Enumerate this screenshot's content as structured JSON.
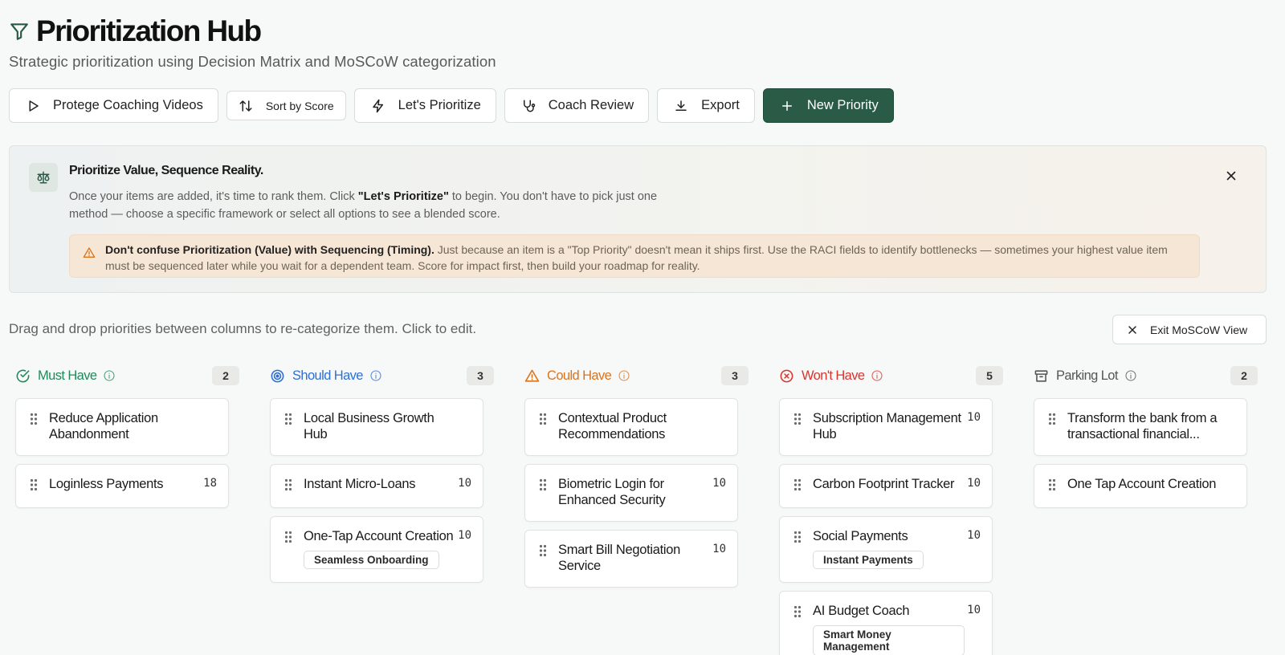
{
  "header": {
    "title": "Prioritization Hub",
    "subtitle": "Strategic prioritization using Decision Matrix and MoSCoW categorization"
  },
  "toolbar": {
    "protege_label": "Protege Coaching Videos",
    "sort_label": "Sort by Score",
    "prioritize_label": "Let's Prioritize",
    "coach_label": "Coach Review",
    "export_label": "Export",
    "new_label": "New Priority"
  },
  "banner": {
    "title": "Prioritize Value, Sequence Reality.",
    "body_1": "Once your items are added, it's time to rank them. Click ",
    "body_bold": "\"Let's Prioritize\"",
    "body_2": " to begin. You don't have to pick just one method — choose a specific framework or select all options to see a blended score.",
    "callout_bold": "Don't confuse Prioritization (Value) with Sequencing (Timing).",
    "callout_text": " Just because an item is a \"Top Priority\" doesn't mean it ships first. Use the RACI fields to identify bottlenecks — sometimes your highest value item must be sequenced later while you wait for a dependent team. Score for impact first, then build your roadmap for reality."
  },
  "hint": "Drag and drop priorities between columns to re-categorize them. Click to edit.",
  "exit_label": "Exit MoSCoW View",
  "columns": [
    {
      "title": "Must Have",
      "count": "2",
      "color": "#1f8a5a",
      "cards": [
        {
          "title": "Reduce Application Abandonment",
          "score": "",
          "tag": ""
        },
        {
          "title": "Loginless Payments",
          "score": "18",
          "tag": ""
        }
      ]
    },
    {
      "title": "Should Have",
      "count": "3",
      "color": "#2f6fd1",
      "cards": [
        {
          "title": "Local Business Growth Hub",
          "score": "",
          "tag": ""
        },
        {
          "title": "Instant Micro-Loans",
          "score": "10",
          "tag": ""
        },
        {
          "title": "One-Tap Account Creation",
          "score": "10",
          "tag": "Seamless Onboarding"
        }
      ]
    },
    {
      "title": "Could Have",
      "count": "3",
      "color": "#d9741f",
      "cards": [
        {
          "title": "Contextual Product Recommendations",
          "score": "",
          "tag": ""
        },
        {
          "title": "Biometric Login for Enhanced Security",
          "score": "10",
          "tag": ""
        },
        {
          "title": "Smart Bill Negotiation Service",
          "score": "10",
          "tag": ""
        }
      ]
    },
    {
      "title": "Won't Have",
      "count": "5",
      "color": "#d9352f",
      "cards": [
        {
          "title": "Subscription Management Hub",
          "score": "10",
          "tag": ""
        },
        {
          "title": "Carbon Footprint Tracker",
          "score": "10",
          "tag": ""
        },
        {
          "title": "Social Payments",
          "score": "10",
          "tag": "Instant Payments"
        },
        {
          "title": "AI Budget Coach",
          "score": "10",
          "tag": "Smart Money Management"
        }
      ]
    },
    {
      "title": "Parking Lot",
      "count": "2",
      "color": "#555555",
      "cards": [
        {
          "title": "Transform the bank from a transactional financial...",
          "score": "",
          "tag": ""
        },
        {
          "title": "One Tap Account Creation",
          "score": "",
          "tag": ""
        }
      ]
    }
  ],
  "icons": {
    "title": "filter-icon",
    "protege": "play-icon",
    "sort": "sort-arrows-icon",
    "prioritize": "lightning-icon",
    "coach": "stethoscope-icon",
    "export": "download-icon",
    "new": "plus-icon",
    "banner": "scale-icon",
    "close": "close-icon",
    "warning": "warning-icon",
    "must": "check-circle-icon",
    "should": "target-icon",
    "could": "warning-triangle-icon",
    "wont": "x-circle-icon",
    "parking": "archive-icon",
    "info": "info-icon",
    "drag": "drag-handle-icon"
  }
}
